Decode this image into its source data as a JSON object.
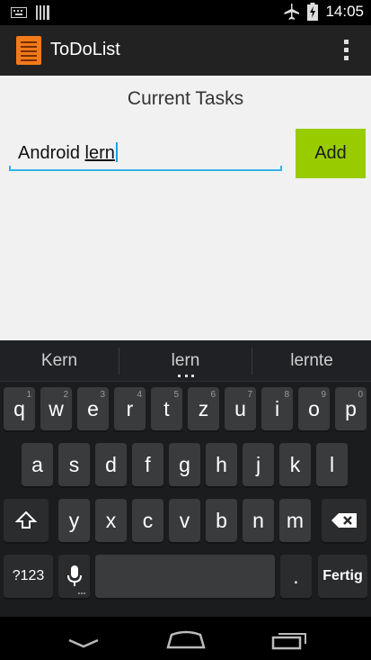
{
  "status_bar": {
    "time": "14:05"
  },
  "app": {
    "title": "ToDoList"
  },
  "main": {
    "header": "Current Tasks",
    "input": {
      "value_prefix": "Android ",
      "value_composing": "lern"
    },
    "add_button": "Add"
  },
  "keyboard": {
    "suggestions": [
      "Kern",
      "lern",
      "lernte"
    ],
    "row1": [
      {
        "label": "q",
        "sub": "1"
      },
      {
        "label": "w",
        "sub": "2"
      },
      {
        "label": "e",
        "sub": "3"
      },
      {
        "label": "r",
        "sub": "4"
      },
      {
        "label": "t",
        "sub": "5"
      },
      {
        "label": "z",
        "sub": "6"
      },
      {
        "label": "u",
        "sub": "7"
      },
      {
        "label": "i",
        "sub": "8"
      },
      {
        "label": "o",
        "sub": "9"
      },
      {
        "label": "p",
        "sub": "0"
      }
    ],
    "row2": [
      "a",
      "s",
      "d",
      "f",
      "g",
      "h",
      "j",
      "k",
      "l"
    ],
    "row3": [
      "y",
      "x",
      "c",
      "v",
      "b",
      "n",
      "m"
    ],
    "symbols_key": "?123",
    "period_key": ".",
    "enter_key": "Fertig"
  }
}
